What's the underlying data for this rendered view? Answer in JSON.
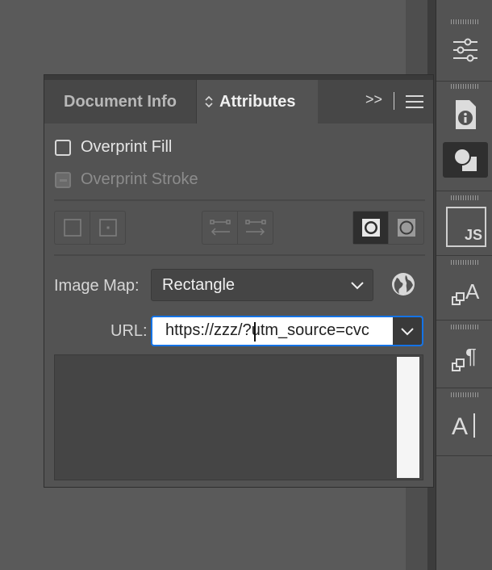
{
  "panel": {
    "tabs": [
      {
        "label": "Document Info",
        "active": false
      },
      {
        "label": "Attributes",
        "active": true
      }
    ],
    "collapse_label": ">>",
    "menu_icon": "hamburger-menu-icon"
  },
  "attributes": {
    "overprint_fill": {
      "label": "Overprint Fill",
      "checked": false
    },
    "overprint_stroke": {
      "label": "Overprint Stroke",
      "state": "mixed",
      "disabled": true
    },
    "image_map": {
      "label": "Image Map:",
      "value": "Rectangle"
    },
    "url": {
      "label": "URL:",
      "value": "https://zzz/?utm_source=cvc"
    }
  },
  "dock": {
    "icons": [
      "properties-sliders-icon",
      "document-info-icon",
      "attributes-icon",
      "javascript-icon",
      "character-style-icon",
      "paragraph-style-icon",
      "type-cursor-icon"
    ]
  },
  "colors": {
    "accent": "#1473e6",
    "panel": "#535353",
    "background": "#5a5a5a"
  }
}
